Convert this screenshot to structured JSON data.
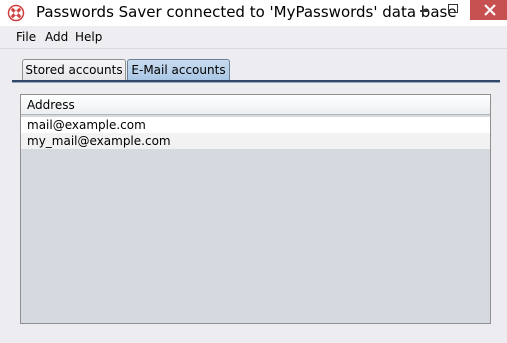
{
  "window": {
    "title": "Passwords Saver connected to 'MyPasswords' data base",
    "close_color": "#c75050"
  },
  "menubar": {
    "items": [
      "File",
      "Add",
      "Help"
    ]
  },
  "tabs": [
    {
      "label": "Stored accounts",
      "selected": false
    },
    {
      "label": "E-Mail accounts",
      "selected": true
    }
  ],
  "table": {
    "columns": [
      "Address"
    ],
    "rows": [
      [
        "mail@example.com"
      ],
      [
        "my_mail@example.com"
      ]
    ]
  },
  "colors": {
    "selected_tab": "#a9c6e5",
    "tab_underline": "#34496a",
    "table_background": "#d6d9df"
  }
}
